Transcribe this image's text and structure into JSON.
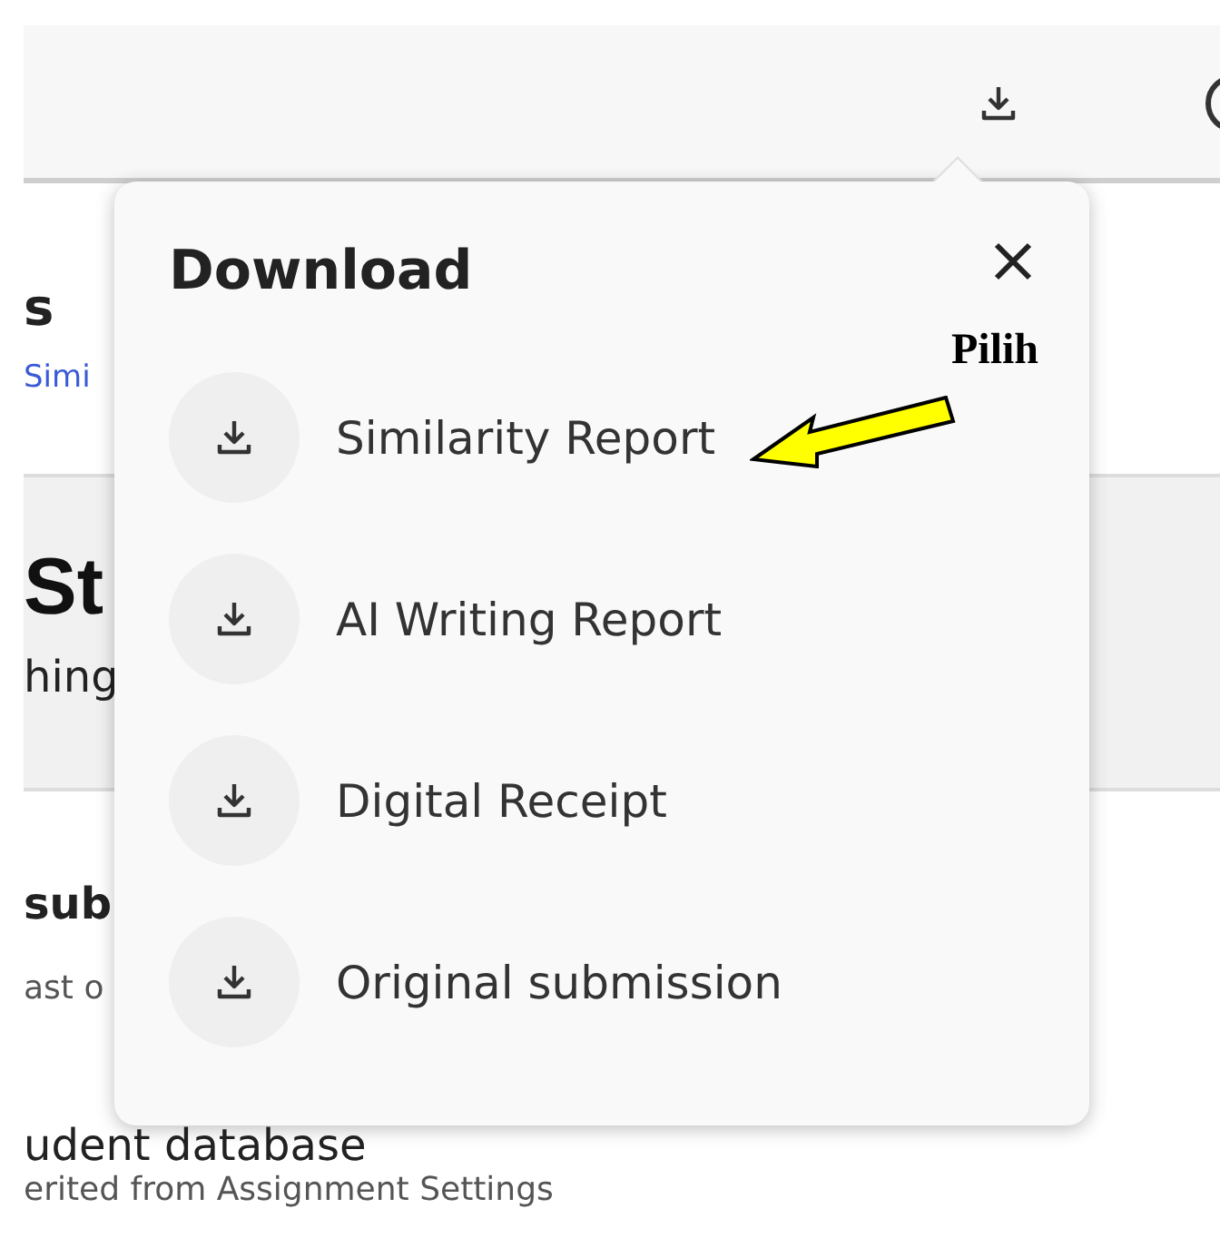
{
  "page": {
    "title_fragment": "s",
    "link_fragment": "Simi",
    "section_heading": "St",
    "section_subtitle": "hing",
    "submission_heading": "sub",
    "submission_note": "ast o",
    "database_label": "udent database",
    "database_note": "erited from Assignment Settings"
  },
  "download_popup": {
    "title": "Download",
    "items": [
      {
        "label": "Similarity Report"
      },
      {
        "label": "AI Writing Report"
      },
      {
        "label": "Digital Receipt"
      },
      {
        "label": "Original submission"
      }
    ]
  },
  "annotation": {
    "label": "Pilih"
  }
}
